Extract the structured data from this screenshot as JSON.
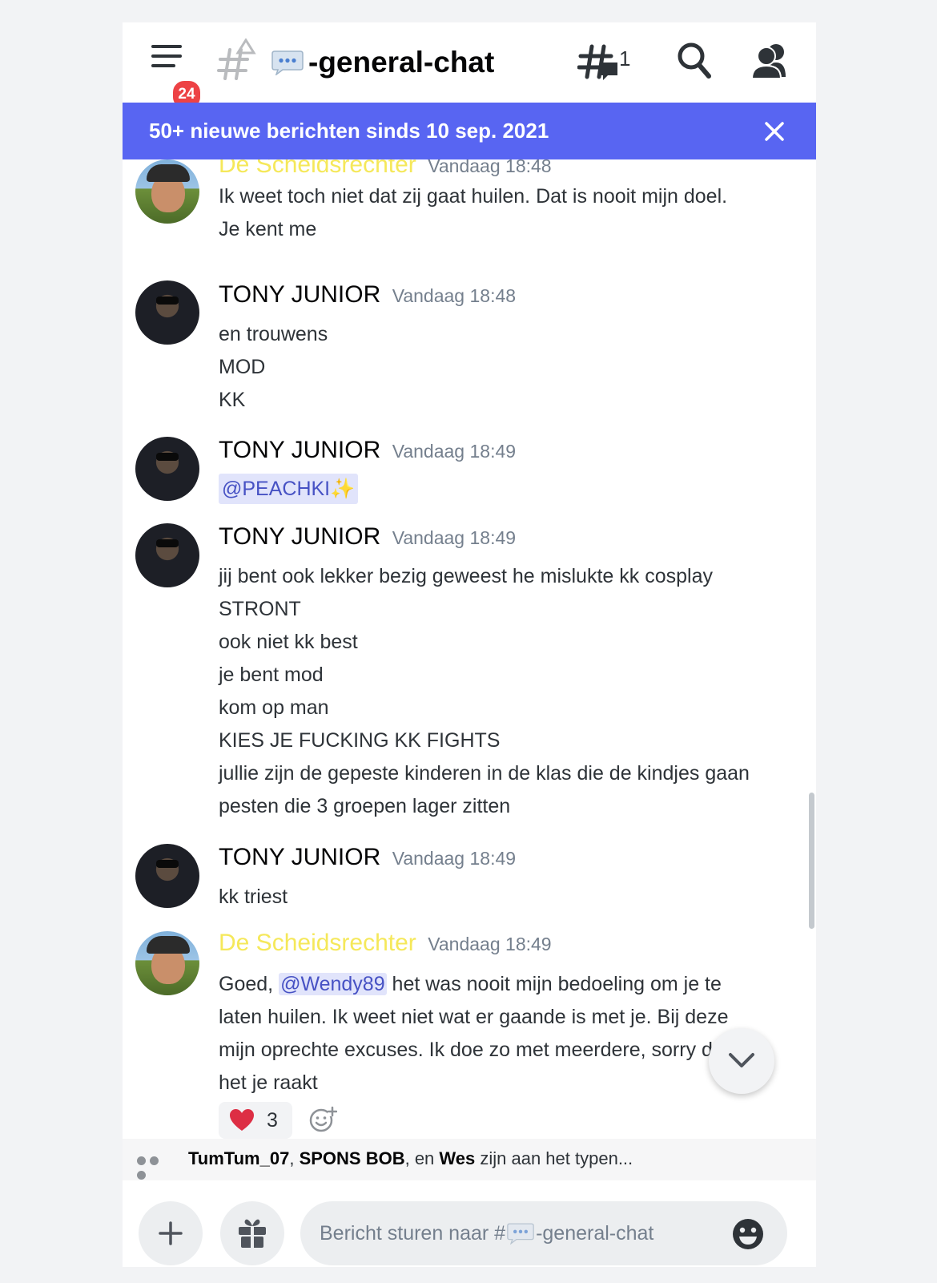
{
  "header": {
    "unread_badge": "24",
    "channel_prefix_icon": "speech-bubble-dots-icon",
    "channel_name": "-general-chat",
    "threads_count": "1"
  },
  "new_messages_bar": {
    "text": "50+ nieuwe berichten sinds 10 sep. 2021"
  },
  "messages": [
    {
      "author": "De Scheidsrechter",
      "time": "Vandaag 18:48",
      "lines": [
        "Ik weet toch niet dat zij gaat huilen. Dat is nooit mijn doel.",
        "Je kent me"
      ]
    },
    {
      "author": "TONY JUNIOR",
      "time": "Vandaag 18:48",
      "lines": [
        "en trouwens",
        "MOD",
        "KK"
      ]
    },
    {
      "author": "TONY JUNIOR",
      "time": "Vandaag 18:49",
      "mention": "@PEACHKI",
      "mention_suffix": "✨"
    },
    {
      "author": "TONY JUNIOR",
      "time": "Vandaag 18:49",
      "lines": [
        "jij bent ook lekker bezig geweest he mislukte kk cosplay",
        "STRONT",
        "ook niet kk best",
        "je bent mod",
        "kom op man",
        "KIES JE FUCKING KK FIGHTS",
        "jullie zijn de gepeste kinderen in de klas die de kindjes gaan",
        "pesten die 3 groepen lager zitten"
      ]
    },
    {
      "author": "TONY JUNIOR",
      "time": "Vandaag 18:49",
      "lines": [
        "kk triest"
      ]
    },
    {
      "author": "De Scheidsrechter",
      "time": "Vandaag 18:49",
      "line1_pre": "Goed, ",
      "line1_mention": "@Wendy89",
      "line1_post": " het was nooit mijn bedoeling om je te",
      "lines": [
        "laten huilen. Ik weet niet wat er gaande is met je. Bij deze",
        "mijn oprechte excuses. Ik doe zo met meerdere, sorry dat",
        "het je raakt"
      ],
      "reaction_count": "3"
    }
  ],
  "typing": {
    "user1": "TumTum_07",
    "sep1": ", ",
    "user2": "SPONS BOB",
    "sep2": ", en ",
    "user3": "Wes",
    "suffix": " zijn aan het typen..."
  },
  "composer": {
    "placeholder_pre": "Bericht sturen naar #",
    "placeholder_channel": "-general-chat"
  },
  "colors": {
    "accent": "#5865f2",
    "badge": "#ed4245",
    "scheidsrechter_name": "#f5e85a",
    "mention_bg": "#e1e4fb",
    "mention_text": "#4752c4"
  }
}
